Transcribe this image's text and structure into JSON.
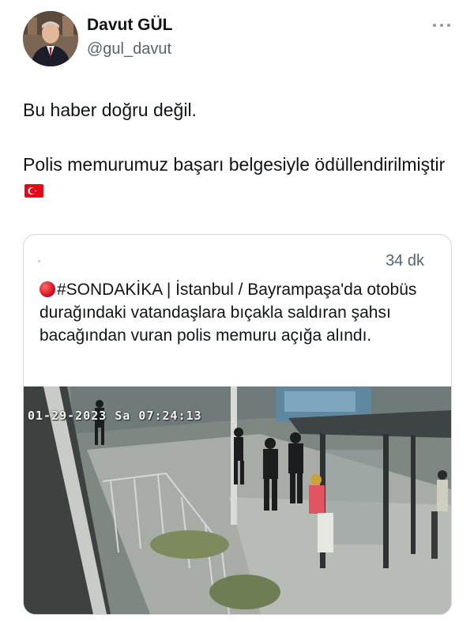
{
  "author": {
    "name": "Davut GÜL",
    "handle": "@gul_davut",
    "avatar_icon": "profile-photo"
  },
  "tweet": {
    "paragraph1": "Bu haber doğru değil.",
    "paragraph2": "Polis memurumuz başarı belgesiyle ödüllendirilmiştir",
    "flag_icon": "turkey-flag-icon"
  },
  "quote": {
    "time": "34 dk",
    "hashtag": "#SONDAKİKA",
    "text": " | İstanbul / Bayrampaşa'da otobüs durağındaki vatandaşlara bıçakla saldıran şahsı bacağından vuran polis memuru açığa alındı.",
    "media": {
      "timestamp": "01-29-2023 Sa 07:24:13"
    }
  },
  "colors": {
    "text": "#0f1419",
    "secondary": "#536471",
    "border": "#cfd9de",
    "red_dot": "#d0021b",
    "flag_red": "#e30a17"
  }
}
